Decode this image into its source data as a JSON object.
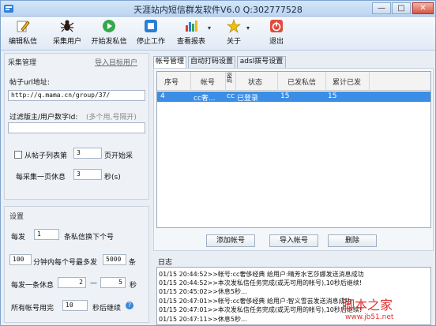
{
  "window": {
    "title": "天涯站内短信群发软件V6.0  Q:302777528",
    "controls": {
      "minimize": "—",
      "maximize": "□",
      "close": "✕"
    }
  },
  "toolbar": {
    "items": [
      {
        "label": "编辑私信",
        "icon": "pencil-icon"
      },
      {
        "label": "采集用户",
        "icon": "spider-icon"
      },
      {
        "label": "开始发私信",
        "icon": "play-icon"
      },
      {
        "label": "停止工作",
        "icon": "stop-icon"
      },
      {
        "label": "查看报表",
        "icon": "report-icon"
      },
      {
        "label": "关于",
        "icon": "star-icon"
      },
      {
        "label": "退出",
        "icon": "exit-icon"
      }
    ],
    "dropdown_arrow": "▾"
  },
  "collect": {
    "title": "采集管理",
    "import_link": "导入目标用户",
    "url_label": "帖子url地址:",
    "url_value": "http://q.mama.cn/group/37/",
    "filter_label": "过滤版主/用户数字Id:",
    "filter_hint": "(多个用,号隔开)",
    "filter_value": "",
    "from_label": "从帖子列表第",
    "from_value": "3",
    "from_suffix": "页开始采",
    "rest_label": "每采集一页休息",
    "rest_value": "3",
    "rest_suffix": "秒(s)"
  },
  "settings": {
    "title": "设置",
    "per_send_label": "每发",
    "per_send_value": "1",
    "per_send_suffix": "条私信换下个号",
    "minutes_value": "100",
    "minutes_label": "分钟内每个号最多发",
    "max_value": "5000",
    "max_suffix": "条",
    "rest_label": "每发一条休息",
    "rest_min": "2",
    "dash": "—",
    "rest_max": "5",
    "rest_unit": "秒",
    "all_used_label": "所有帐号用完",
    "all_used_value": "10",
    "all_used_suffix": "秒后继续",
    "help_mark": "?"
  },
  "tabs": [
    {
      "label": "帐号管理",
      "active": true
    },
    {
      "label": "自动打码设置",
      "active": false
    },
    {
      "label": "adsl拨号设置",
      "active": false
    }
  ],
  "accounts": {
    "headers": [
      "序号",
      "帐号",
      "密码",
      "状态",
      "已发私信",
      "累计已发"
    ],
    "rows": [
      {
        "id": "4",
        "account": "cc奢...",
        "password": "cc",
        "status": "已登录",
        "sent": "15",
        "total": "15"
      }
    ],
    "buttons": {
      "add": "添加帐号",
      "import": "导入帐号",
      "delete": "删除"
    }
  },
  "log": {
    "title": "日志",
    "lines": [
      "01/15 20:44:52>>帐号:cc奢侈经典 给用户:晴芳水艺莎娜发送消息成功",
      "01/15 20:44:52>>本次发私信任务完成(或无可用的帐号),10秒后继续!",
      "01/15 20:45:02>>休息5秒...",
      "01/15 20:47:01>>帐号:cc奢侈经典 给用户:智义雪芸发送消息成功",
      "01/15 20:47:01>>本次发私信任务完成(或无可用的帐号),10秒后继续!",
      "01/15 20:47:11>>休息5秒..."
    ]
  },
  "watermark": {
    "text": "脚本之家",
    "url": "www.jb51.net"
  }
}
